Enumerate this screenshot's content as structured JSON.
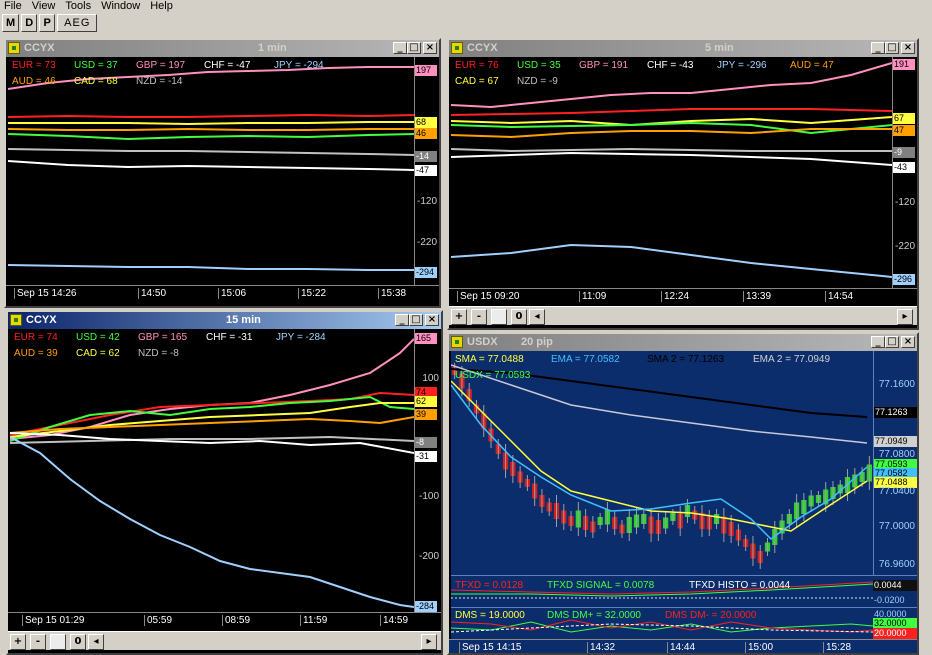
{
  "menu": [
    "File",
    "View",
    "Tools",
    "Window",
    "Help"
  ],
  "toolbar": {
    "m": "M",
    "d": "D",
    "p": "P",
    "aeg": "AEG"
  },
  "scroll": {
    "plus": "+",
    "minus": "-",
    "zero": "0",
    "left": "◂",
    "right": "▸"
  },
  "windows": {
    "w1": {
      "title": "CCYX",
      "period": "1 min",
      "legend_row1": [
        {
          "label": "EUR = 73",
          "color": "#ff2020"
        },
        {
          "label": "USD = 37",
          "color": "#40ff40"
        },
        {
          "label": "GBP = 197",
          "color": "#ff90c0"
        },
        {
          "label": "CHF = -47",
          "color": "#ffffff"
        },
        {
          "label": "JPY = -294",
          "color": "#a0d0ff"
        }
      ],
      "legend_row2": [
        {
          "label": "AUD = 46",
          "color": "#ffa000"
        },
        {
          "label": "CAD = 68",
          "color": "#ffff40"
        },
        {
          "label": "NZD = -14",
          "color": "#c0c0c0"
        }
      ],
      "axis_labels": [
        "-120",
        "-220"
      ],
      "tags": [
        {
          "text": "197",
          "bg": "#ff90c0",
          "fg": "#000"
        },
        {
          "text": "68",
          "bg": "#ffff40",
          "fg": "#000"
        },
        {
          "text": "46",
          "bg": "#ffa000",
          "fg": "#000"
        },
        {
          "text": "-14",
          "bg": "#808080",
          "fg": "#fff"
        },
        {
          "text": "-47",
          "bg": "#ffffff",
          "fg": "#000"
        },
        {
          "text": "-294",
          "bg": "#a0d0ff",
          "fg": "#000"
        }
      ],
      "times": [
        "Sep 15 14:26",
        "14:50",
        "15:06",
        "15:22",
        "15:38"
      ]
    },
    "w2": {
      "title": "CCYX",
      "period": "5 min",
      "legend_row1": [
        {
          "label": "EUR = 76",
          "color": "#ff2020"
        },
        {
          "label": "USD = 35",
          "color": "#40ff40"
        },
        {
          "label": "GBP = 191",
          "color": "#ff90c0"
        },
        {
          "label": "CHF = -43",
          "color": "#ffffff"
        },
        {
          "label": "JPY = -296",
          "color": "#a0d0ff"
        },
        {
          "label": "AUD = 47",
          "color": "#ffa000"
        }
      ],
      "legend_row2": [
        {
          "label": "CAD = 67",
          "color": "#ffff40"
        },
        {
          "label": "NZD = -9",
          "color": "#c0c0c0"
        }
      ],
      "axis_labels": [
        "-120",
        "-220"
      ],
      "tags": [
        {
          "text": "191",
          "bg": "#ff90c0",
          "fg": "#000"
        },
        {
          "text": "67",
          "bg": "#ffff40",
          "fg": "#000"
        },
        {
          "text": "47",
          "bg": "#ffa000",
          "fg": "#000"
        },
        {
          "text": "-9",
          "bg": "#808080",
          "fg": "#fff"
        },
        {
          "text": "-43",
          "bg": "#ffffff",
          "fg": "#000"
        },
        {
          "text": "-296",
          "bg": "#a0d0ff",
          "fg": "#000"
        }
      ],
      "times": [
        "Sep 15 09:20",
        "11:09",
        "12:24",
        "13:39",
        "14:54"
      ]
    },
    "w3": {
      "title": "CCYX",
      "period": "15 min",
      "legend_row1": [
        {
          "label": "EUR = 74",
          "color": "#ff2020"
        },
        {
          "label": "USD = 42",
          "color": "#40ff40"
        },
        {
          "label": "GBP = 165",
          "color": "#ff90c0"
        },
        {
          "label": "CHF = -31",
          "color": "#ffffff"
        },
        {
          "label": "JPY = -284",
          "color": "#a0d0ff"
        }
      ],
      "legend_row2": [
        {
          "label": "AUD = 39",
          "color": "#ffa000"
        },
        {
          "label": "CAD = 62",
          "color": "#ffff40"
        },
        {
          "label": "NZD = -8",
          "color": "#c0c0c0"
        }
      ],
      "axis_labels": [
        "100",
        "-100",
        "-200"
      ],
      "tags": [
        {
          "text": "165",
          "bg": "#ff90c0",
          "fg": "#000"
        },
        {
          "text": "74",
          "bg": "#ff2020",
          "fg": "#000"
        },
        {
          "text": "62",
          "bg": "#ffff40",
          "fg": "#000"
        },
        {
          "text": "39",
          "bg": "#ffa000",
          "fg": "#000"
        },
        {
          "text": "-8",
          "bg": "#808080",
          "fg": "#fff"
        },
        {
          "text": "-31",
          "bg": "#ffffff",
          "fg": "#000"
        },
        {
          "text": "-284",
          "bg": "#a0d0ff",
          "fg": "#000"
        }
      ],
      "times": [
        "Sep 15 01:29",
        "05:59",
        "08:59",
        "11:59",
        "14:59"
      ]
    },
    "w4": {
      "title": "USDX",
      "period": "20 pip",
      "legend_row1": [
        {
          "label": "SMA = 77.0488",
          "color": "#ffff40"
        },
        {
          "label": "EMA = 77.0582",
          "color": "#40c0ff"
        },
        {
          "label": "SMA 2 = 77.1263",
          "color": "#000000"
        },
        {
          "label": "EMA 2 = 77.0949",
          "color": "#d0d0d0"
        }
      ],
      "legend_row2": [
        {
          "label": "USDX = 77.0593",
          "color": "#40ff40"
        }
      ],
      "axis_labels": [
        "77.1600",
        "77.0800",
        "77.0400",
        "77.0000",
        "76.9600"
      ],
      "tags": [
        {
          "text": "77.1263",
          "bg": "#000000",
          "fg": "#fff"
        },
        {
          "text": "77.0949",
          "bg": "#d0d0d0",
          "fg": "#000"
        },
        {
          "text": "77.0593",
          "bg": "#40ff40",
          "fg": "#000"
        },
        {
          "text": "77.0582",
          "bg": "#40c0ff",
          "fg": "#000"
        },
        {
          "text": "77.0488",
          "bg": "#ffff40",
          "fg": "#000"
        }
      ],
      "tfxd_row": [
        {
          "label": "TFXD = 0.0128",
          "color": "#ff2020"
        },
        {
          "label": "TFXD SIGNAL = 0.0078",
          "color": "#40ff40"
        },
        {
          "label": "TFXD HISTO = 0.0044",
          "color": "#ffffff"
        }
      ],
      "tfxd_axis": [
        {
          "text": "0.0044",
          "bg": "#101010",
          "fg": "#fff"
        },
        {
          "text": "-0.0200",
          "bg": "none",
          "fg": "#a0d0ff"
        }
      ],
      "dms_row": [
        {
          "label": "DMS = 19.0000",
          "color": "#ffff40"
        },
        {
          "label": "DMS DM+ = 32.0000",
          "color": "#40ff40"
        },
        {
          "label": "DMS DM- = 20.0000",
          "color": "#ff2020"
        }
      ],
      "dms_axis": [
        {
          "text": "40.0000",
          "bg": "none",
          "fg": "#a0d0ff"
        },
        {
          "text": "32.0000",
          "bg": "#40ff40",
          "fg": "#000"
        },
        {
          "text": "20.0000",
          "bg": "#ff2020",
          "fg": "#fff"
        }
      ],
      "times": [
        "Sep 15 14:15",
        "14:32",
        "14:44",
        "15:00",
        "15:28"
      ]
    }
  }
}
